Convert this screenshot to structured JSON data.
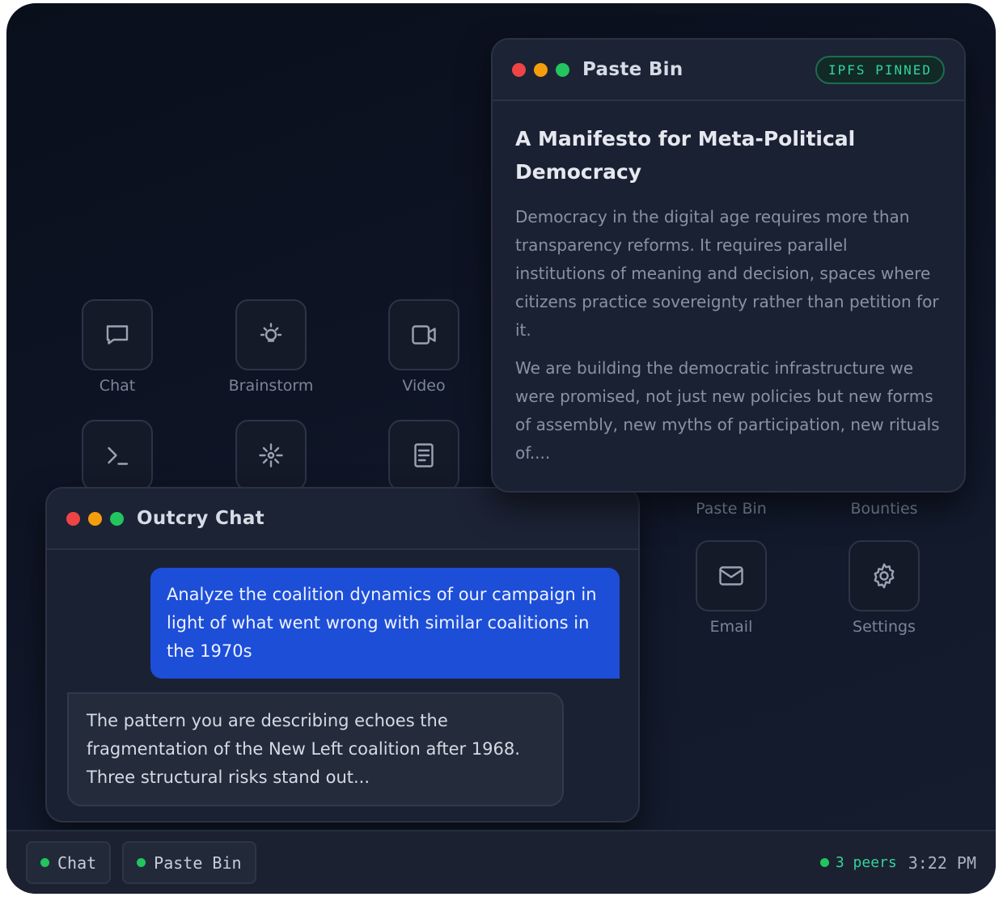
{
  "desktop_icons": [
    {
      "label": "Chat",
      "icon": "chat-bubble-icon"
    },
    {
      "label": "Brainstorm",
      "icon": "lightbulb-icon"
    },
    {
      "label": "Video",
      "icon": "video-camera-icon"
    },
    {
      "label": "",
      "icon": "terminal-icon"
    },
    {
      "label": "",
      "icon": "sparkle-icon"
    },
    {
      "label": "",
      "icon": "document-icon"
    },
    {
      "label": "Paste Bin",
      "icon": ""
    },
    {
      "label": "Bounties",
      "icon": ""
    },
    {
      "label": "Email",
      "icon": "envelope-icon"
    },
    {
      "label": "Settings",
      "icon": "gear-icon"
    }
  ],
  "paste_bin": {
    "title": "Paste Bin",
    "badge": "IPFS PINNED",
    "doc_title": "A Manifesto for Meta-Political Democracy",
    "paragraphs": [
      "Democracy in the digital age requires more than transparency reforms. It requires parallel institutions of meaning and decision, spaces where citizens practice sovereignty rather than petition for it.",
      "We are building the democratic infrastructure we were promised, not just new policies but new forms of assembly, new myths of participation, new rituals of...."
    ]
  },
  "chat": {
    "title": "Outcry Chat",
    "messages": [
      {
        "role": "user",
        "text": "Analyze the coalition dynamics of our campaign in light of what went wrong with similar coalitions in the 1970s"
      },
      {
        "role": "assistant",
        "text": "The pattern you are describing echoes the fragmentation of the New Left coalition after 1968. Three structural risks stand out..."
      }
    ]
  },
  "taskbar": {
    "items": [
      "Chat",
      "Paste Bin"
    ],
    "peers": "3 peers",
    "time": "3:22 PM",
    "status_color": "#22c55e"
  },
  "colors": {
    "accent_user_bubble": "#1d4ed8",
    "badge_green": "#34d399",
    "dot_red": "#ef4444",
    "dot_yellow": "#f59e0b",
    "dot_green": "#22c55e"
  }
}
